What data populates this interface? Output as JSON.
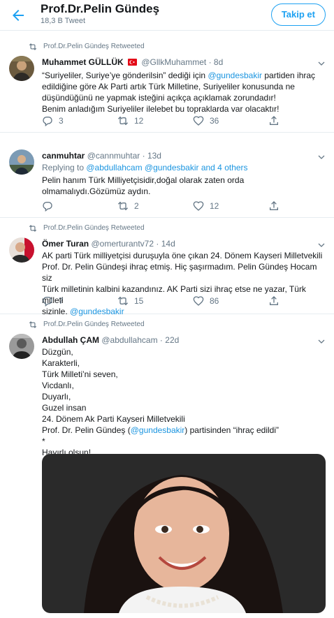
{
  "header": {
    "title": "Prof.Dr.Pelin Gündeş",
    "subtitle": "18,3 B Tweet",
    "follow_label": "Takip et"
  },
  "colors": {
    "accent": "#1da1f2",
    "link": "#1b95e0",
    "muted": "#657786",
    "divider": "#e6ecf0"
  },
  "tweets": [
    {
      "retweet_label": "Prof.Dr.Pelin Gündeş Retweeted",
      "name": "Muhammet GÜLLÜK",
      "flag": "turkish-flag",
      "handle": "@GllkMuhammet",
      "sep": "·",
      "time": "8d",
      "text": {
        "l1a": "“Suriyeliler, Suriye’ye gönderilsin” dediği için ",
        "l1m": "@gundesbakir",
        "l1b": " partiden ihraç",
        "l2": "edildiğine göre Ak Parti artık Türk Milletine, Suriyeliler konusunda ne",
        "l3": "düşündüğünü ne yapmak isteğini açıkça açıklamak zorundadır!",
        "l4": "Benim anladığım Suriyeliler ilelebet bu topraklarda var olacaktır!"
      },
      "replies": "3",
      "retweets": "12",
      "likes": "36"
    },
    {
      "name": "canmuhtar",
      "handle": "@cannmuhtar",
      "sep": "·",
      "time": "13d",
      "reply_prefix": "Replying to ",
      "reply_mentions": "@abdullahcam @gundesbakir and 4 others",
      "text": {
        "l1": "Pelin hanım Türk Milliyetçisidir,doğal olarak zaten orda",
        "l2": "olmamalıydı.Gözümüz aydın."
      },
      "replies": "",
      "retweets": "2",
      "likes": "12"
    },
    {
      "retweet_label": "Prof.Dr.Pelin Gündeş Retweeted",
      "name": "Ömer Turan",
      "handle": "@omerturantv72",
      "sep": "·",
      "time": "14d",
      "text": {
        "l1": "AK parti Türk milliyetçisi duruşuyla öne çıkan 24. Dönem Kayseri Milletvekili",
        "l2": "Prof. Dr. Pelin Gündeşi ihraç etmiş. Hiç şaşırmadım. Pelin Gündeş Hocam siz",
        "l3": "Türk milletinin kalbini kazandınız. AK Parti sizi ihraç etse ne yazar, Türk milleti",
        "l4a": "sizinle. ",
        "l4m": "@gundesbakir"
      },
      "replies": "7",
      "retweets": "15",
      "likes": "86"
    },
    {
      "retweet_label": "Prof.Dr.Pelin Gündeş Retweeted",
      "name": "Abdullah ÇAM",
      "handle": "@abdullahcam",
      "sep": "·",
      "time": "22d",
      "text": {
        "l1": "Düzgün,",
        "l2": "Karakterli,",
        "l3": "Türk Milleti’ni seven,",
        "l4": "Vicdanlı,",
        "l5": "Duyarlı,",
        "l6": "Guzel insan",
        "l7": "24. Dönem Ak Parti Kayseri Milletvekili",
        "l8a": "Prof. Dr. Pelin Gündeş (",
        "l8m": "@gundesbakir",
        "l8b": ") partisinden “ihraç edildi”",
        "l9": "*",
        "l10": "Hayırlı olsun!"
      }
    }
  ]
}
